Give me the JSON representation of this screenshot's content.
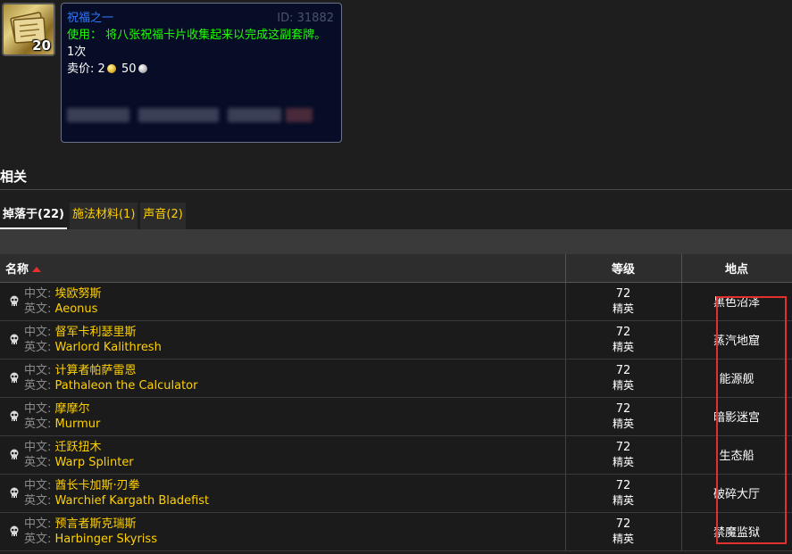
{
  "item": {
    "title": "祝福之一",
    "id_text": "ID: 31882",
    "stack_count": "20",
    "use_text": "使用： 将八张祝福卡片收集起来以完成这副套牌。",
    "charges": "1次",
    "sell_label": "卖价:",
    "sell_gold": "2",
    "sell_silver": "50"
  },
  "related": {
    "title": "相关",
    "tabs": [
      {
        "label": "掉落于(22)"
      },
      {
        "label": "施法材料(1)"
      },
      {
        "label": "声音(2)"
      }
    ]
  },
  "table": {
    "headers": {
      "name": "名称",
      "level": "等级",
      "location": "地点"
    },
    "cn_label": "中文:",
    "en_label": "英文:",
    "rows": [
      {
        "cn": "埃欧努斯",
        "en": "Aeonus",
        "level": "72",
        "cls": "精英",
        "location": "黑色沼泽"
      },
      {
        "cn": "督军卡利瑟里斯",
        "en": "Warlord Kalithresh",
        "level": "72",
        "cls": "精英",
        "location": "蒸汽地窟"
      },
      {
        "cn": "计算者帕萨雷恩",
        "en": "Pathaleon the Calculator",
        "level": "72",
        "cls": "精英",
        "location": "能源舰"
      },
      {
        "cn": "摩摩尔",
        "en": "Murmur",
        "level": "72",
        "cls": "精英",
        "location": "暗影迷宫"
      },
      {
        "cn": "迁跃扭木",
        "en": "Warp Splinter",
        "level": "72",
        "cls": "精英",
        "location": "生态船"
      },
      {
        "cn": "酋长卡加斯·刃拳",
        "en": "Warchief Kargath Bladefist",
        "level": "72",
        "cls": "精英",
        "location": "破碎大厅"
      },
      {
        "cn": "预言者斯克瑞斯",
        "en": "Harbinger Skyriss",
        "level": "72",
        "cls": "精英",
        "location": "禁魔监狱"
      }
    ]
  }
}
